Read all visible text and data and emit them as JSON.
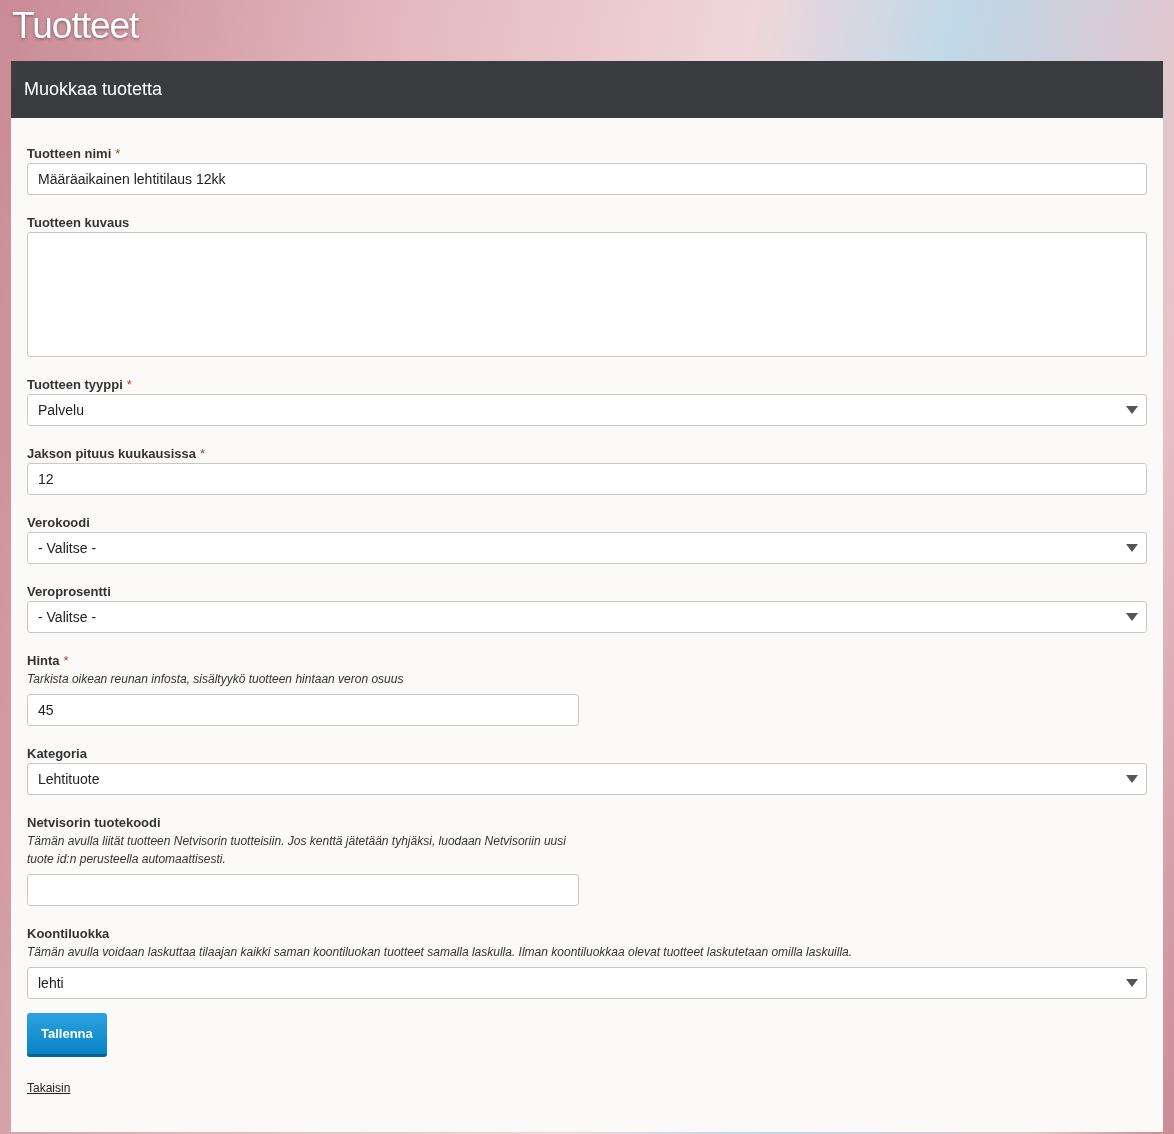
{
  "page_title": "Tuotteet",
  "card": {
    "title": "Muokkaa tuotetta"
  },
  "fields": [
    {
      "kind": "text",
      "label": "Tuotteen nimi",
      "required_mark": "*",
      "value": "Määräaikainen lehtitilaus 12kk",
      "half": false
    },
    {
      "kind": "textarea",
      "label": "Tuotteen kuvaus",
      "half": false
    },
    {
      "kind": "select",
      "label": "Tuotteen tyyppi",
      "required_mark": "*",
      "value": "Palvelu",
      "half": false
    },
    {
      "kind": "text",
      "label": "Jakson pituus kuukausissa",
      "required_mark": "*",
      "value": "12",
      "half": false
    },
    {
      "kind": "select",
      "label": "Verokoodi",
      "value": "- Valitse -",
      "half": false
    },
    {
      "kind": "select",
      "label": "Veroprosentti",
      "value": "- Valitse -",
      "half": false
    },
    {
      "kind": "text",
      "label": "Hinta",
      "required_mark": "*",
      "hint": "Tarkista oikean reunan infosta, sisältyykö tuotteen hintaan veron osuus",
      "value": "45",
      "half": true
    },
    {
      "kind": "select",
      "label": "Kategoria",
      "value": "Lehtituote",
      "half": false
    },
    {
      "kind": "text",
      "label": "Netvisorin tuotekoodi",
      "hint": "Tämän avulla liität tuotteen Netvisorin tuotteisiin. Jos kenttä jätetään tyhjäksi, luodaan Netvisoriin uusi tuote id:n perusteella automaattisesti.",
      "half": true
    },
    {
      "kind": "select",
      "label": "Koontiluokka",
      "hint": "Tämän avulla voidaan laskuttaa tilaajan kaikki saman koontiluokan tuotteet samalla laskulla. Ilman koontiluokkaa olevat tuotteet laskutetaan omilla laskuilla.",
      "value": "lehti",
      "half": false
    }
  ],
  "save_button": "Tallenna",
  "back_link": "Takaisin"
}
